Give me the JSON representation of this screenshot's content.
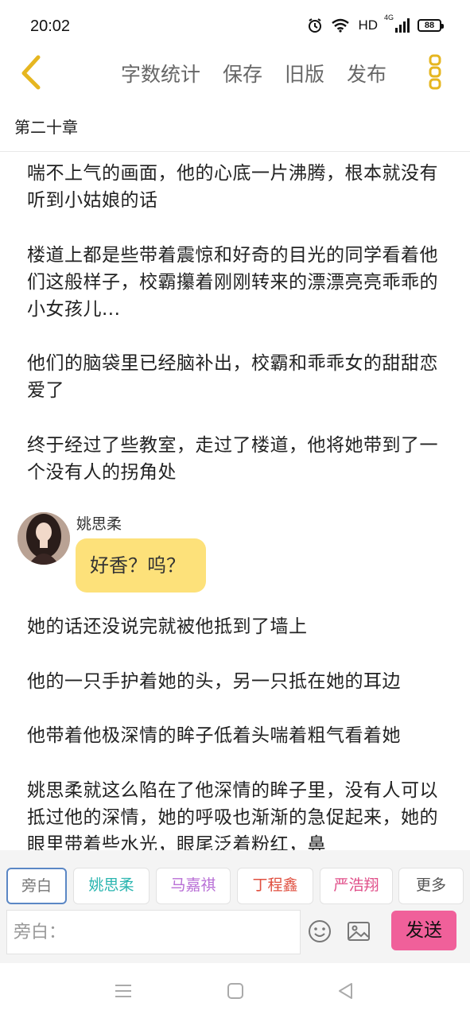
{
  "status_bar": {
    "time": "20:02",
    "network_label": "HD",
    "signal_label": "4G",
    "battery": "88",
    "icons": [
      "alarm-icon",
      "wifi-icon",
      "signal-icon",
      "battery-icon"
    ]
  },
  "toolbar": {
    "back_icon": "chevron-left-icon",
    "word_count": "字数统计",
    "save": "保存",
    "old_version": "旧版",
    "publish": "发布",
    "more_icon": "vertical-dots-icon",
    "accent_color": "#e6b620"
  },
  "chapter": {
    "title": "第二十章"
  },
  "story": {
    "paragraphs": [
      "喘不上气的画面，他的心底一片沸腾，根本就没有听到小姑娘的话",
      "楼道上都是些带着震惊和好奇的目光的同学看着他们这般样子，校霸攥着刚刚转来的漂漂亮亮乖乖的小女孩儿...",
      "他们的脑袋里已经脑补出，校霸和乖乖女的甜甜恋爱了",
      "终于经过了些教室，走过了楼道，他将她带到了一个没有人的拐角处",
      "她的话还没说完就被他抵到了墙上",
      "他的一只手护着她的头，另一只抵在她的耳边",
      "他带着他极深情的眸子低着头喘着粗气看着她",
      "姚思柔就这么陷在了他深情的眸子里，没有人可以抵过他的深情，她的呼吸也渐渐的急促起来，她的眼里带着些水光，眼尾泛着粉红，鼻"
    ],
    "dialogue": {
      "speaker": "姚思柔",
      "text": "好香？呜？",
      "bubble_color": "#fde17a"
    }
  },
  "characters": {
    "items": [
      {
        "label": "旁白",
        "color": "#777777",
        "selected": true
      },
      {
        "label": "姚思柔",
        "color": "#2ab5b0"
      },
      {
        "label": "马嘉祺",
        "color": "#b86fd6"
      },
      {
        "label": "丁程鑫",
        "color": "#e05040"
      },
      {
        "label": "严浩翔",
        "color": "#e0508a"
      },
      {
        "label": "更多",
        "color": "#555555"
      }
    ]
  },
  "composer": {
    "placeholder": "旁白：",
    "emoji_icon": "emoji-icon",
    "image_icon": "image-icon",
    "send": "发送",
    "send_color": "#f0609a"
  },
  "nav": {
    "icons": [
      "menu-icon",
      "home-icon",
      "back-triangle-icon"
    ]
  }
}
